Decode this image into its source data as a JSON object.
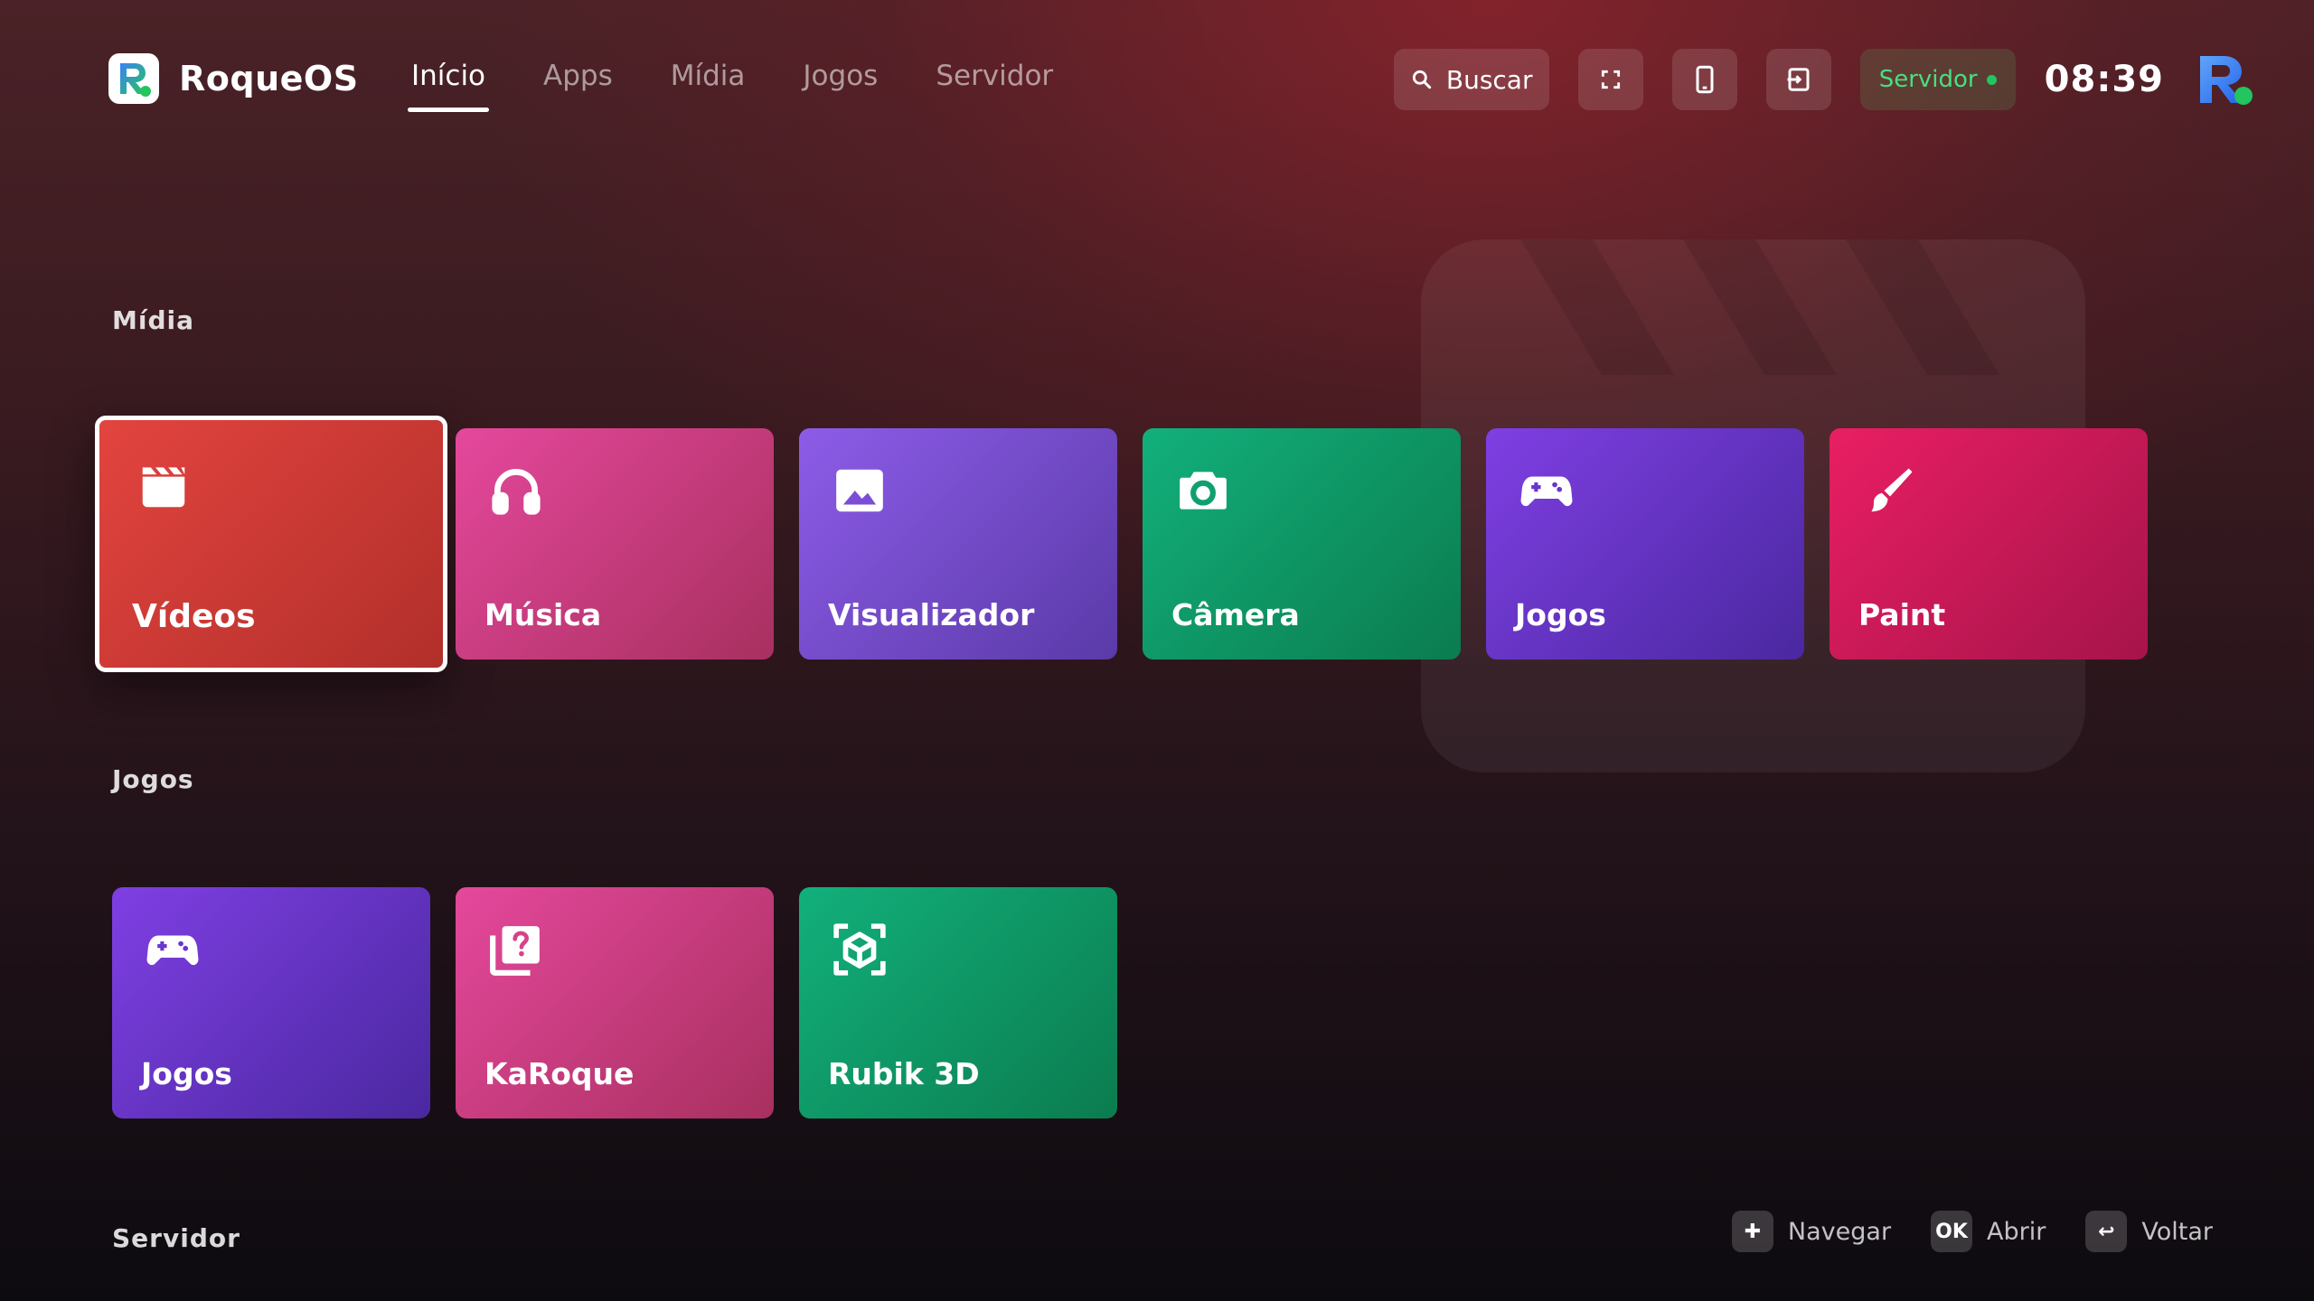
{
  "brand": {
    "name": "RoqueOS"
  },
  "nav": {
    "tabs": [
      {
        "label": "Início",
        "active": true
      },
      {
        "label": "Apps"
      },
      {
        "label": "Mídia"
      },
      {
        "label": "Jogos"
      },
      {
        "label": "Servidor"
      }
    ]
  },
  "header": {
    "search_label": "Buscar",
    "icons": [
      "search-icon",
      "fullscreen-icon",
      "phone-icon",
      "exit-icon"
    ],
    "server_label": "Servidor",
    "server_status_color": "#22c55e",
    "clock": "08:39"
  },
  "sections": {
    "media": {
      "title": "Mídia",
      "tiles": [
        {
          "label": "Vídeos",
          "icon": "clapperboard-icon",
          "color": "#d23a35",
          "focused": true
        },
        {
          "label": "Música",
          "icon": "headphones-icon",
          "color": "#d6428a"
        },
        {
          "label": "Visualizador",
          "icon": "image-icon",
          "color": "#7a4fd6"
        },
        {
          "label": "Câmera",
          "icon": "camera-icon",
          "color": "#10a070"
        },
        {
          "label": "Jogos",
          "icon": "gamepad-icon",
          "color": "#6a35cf"
        },
        {
          "label": "Paint",
          "icon": "brush-icon",
          "color": "#d81b5a"
        }
      ]
    },
    "games": {
      "title": "Jogos",
      "tiles": [
        {
          "label": "Jogos",
          "icon": "gamepad-icon",
          "color": "#6a35cf"
        },
        {
          "label": "KaRoque",
          "icon": "quiz-icon",
          "color": "#d6428a"
        },
        {
          "label": "Rubik 3D",
          "icon": "cube-icon",
          "color": "#10a070"
        }
      ]
    },
    "server": {
      "title": "Servidor"
    }
  },
  "hints": [
    {
      "key": "✚",
      "label": "Navegar",
      "icon": "dpad-icon"
    },
    {
      "key": "OK",
      "label": "Abrir"
    },
    {
      "key": "↩",
      "label": "Voltar",
      "icon": "back-icon"
    }
  ]
}
